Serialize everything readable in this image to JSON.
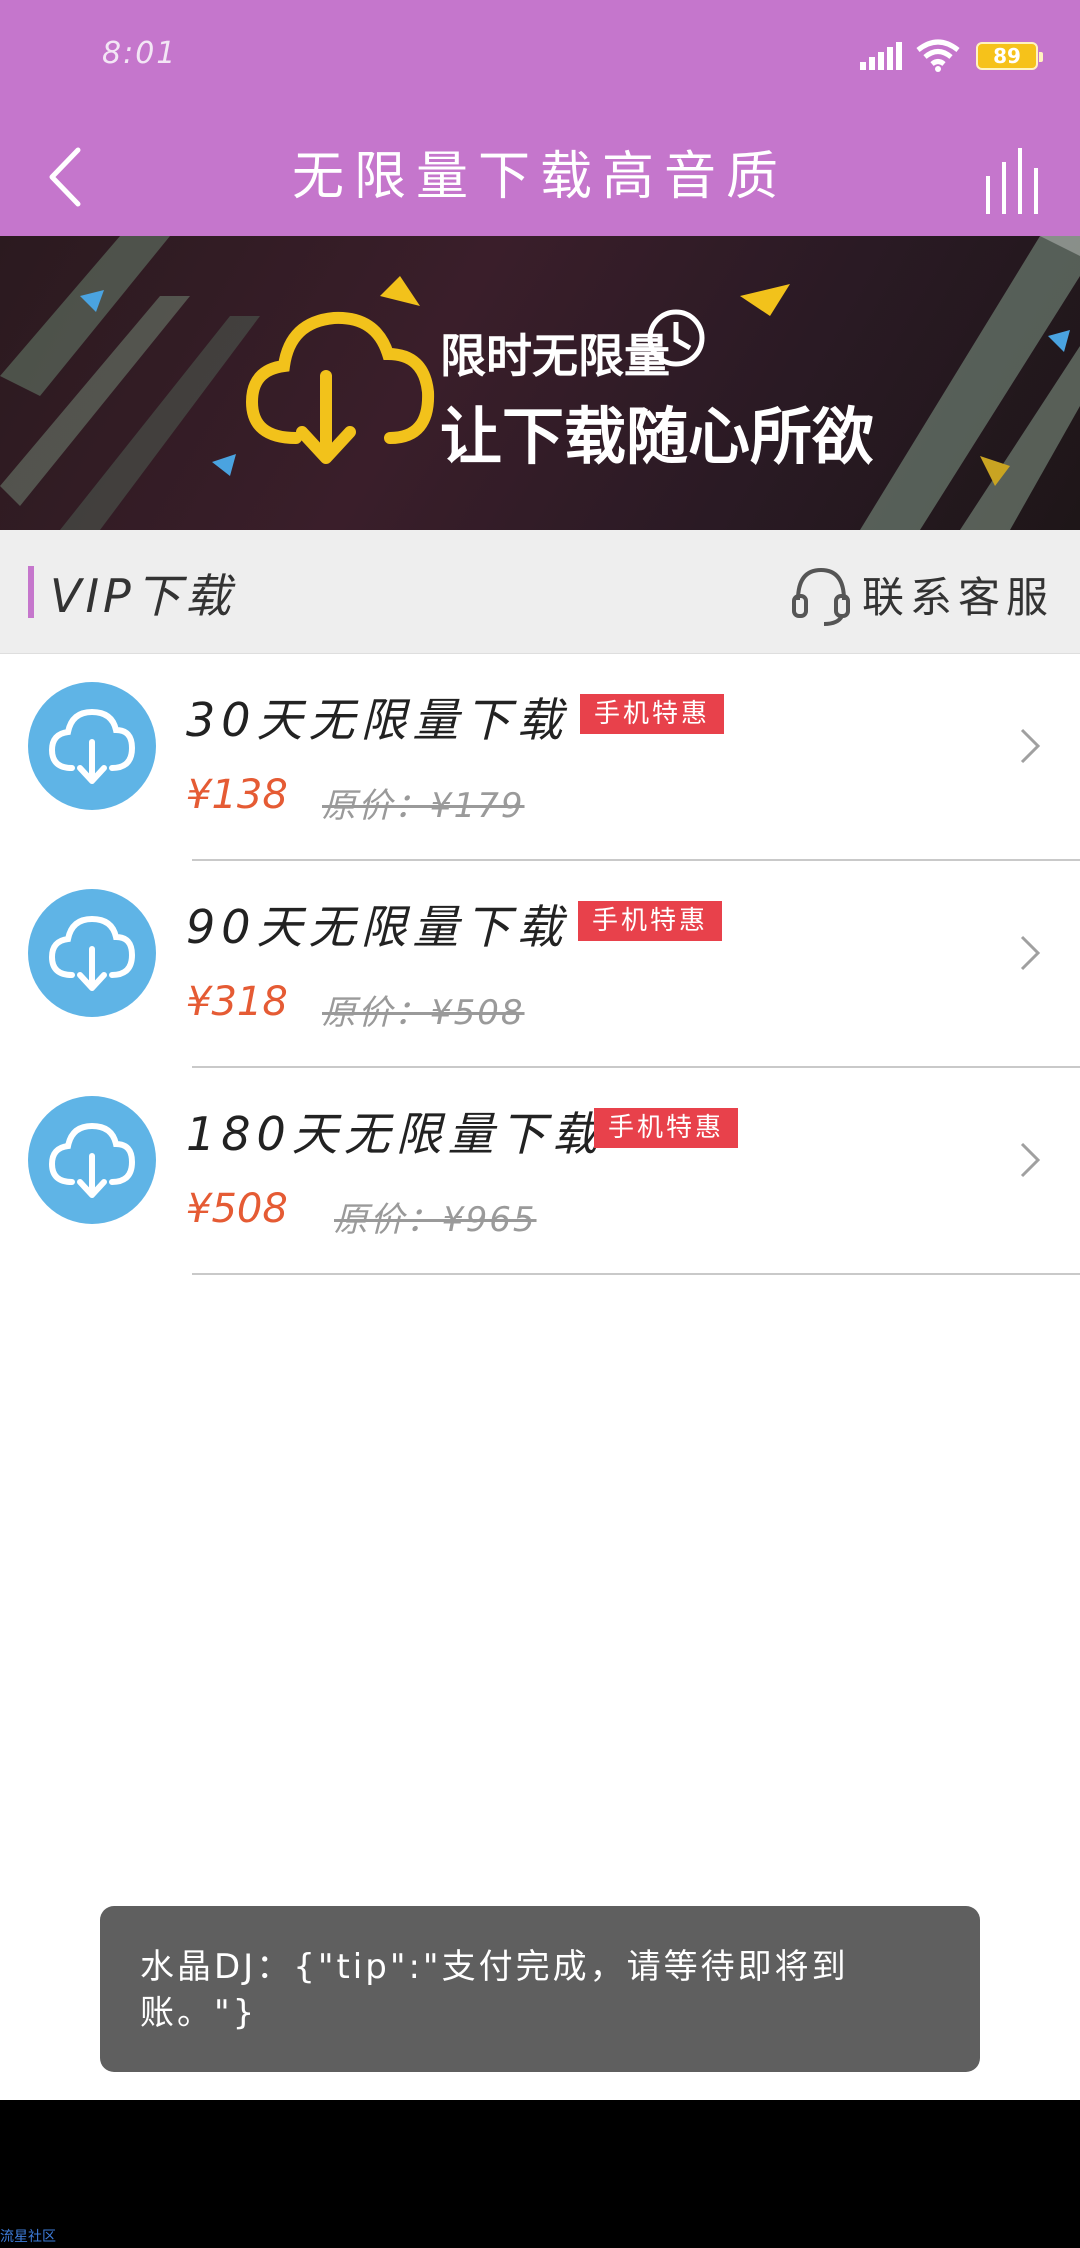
{
  "status_bar": {
    "time": "8:01",
    "battery": "89",
    "icons": [
      "signal-icon",
      "wifi-icon",
      "battery-icon"
    ]
  },
  "header": {
    "title": "无限量下载高音质",
    "back_icon": "back-arrow-icon",
    "menu_icon": "equalizer-bars-icon"
  },
  "banner": {
    "line1": "限时无限量",
    "line2": "让下载随心所欲",
    "icon": "cloud-download-icon"
  },
  "section": {
    "title": "VIP下载",
    "contact_label": "联系客服",
    "contact_icon": "headset-icon"
  },
  "products": [
    {
      "name": "30天无限量下载",
      "badge": "手机特惠",
      "price": "¥138",
      "original": "原价：¥179"
    },
    {
      "name": "90天无限量下载",
      "badge": "手机特惠",
      "price": "¥318",
      "original": "原价：¥508"
    },
    {
      "name": "180天无限量下载",
      "badge": "手机特惠",
      "price": "¥508",
      "original": "原价：¥965"
    }
  ],
  "toast": {
    "text": "水晶DJ：{\"tip\":\"支付完成，请等待即将到账。\"}"
  },
  "watermark": "流星社区",
  "colors": {
    "header_bg": "#c576cc",
    "accent": "#c576cc",
    "price": "#e55b34",
    "badge": "#e8414b",
    "icon_circle": "#5fb4e6",
    "toast_bg": "#5f5f5f"
  }
}
